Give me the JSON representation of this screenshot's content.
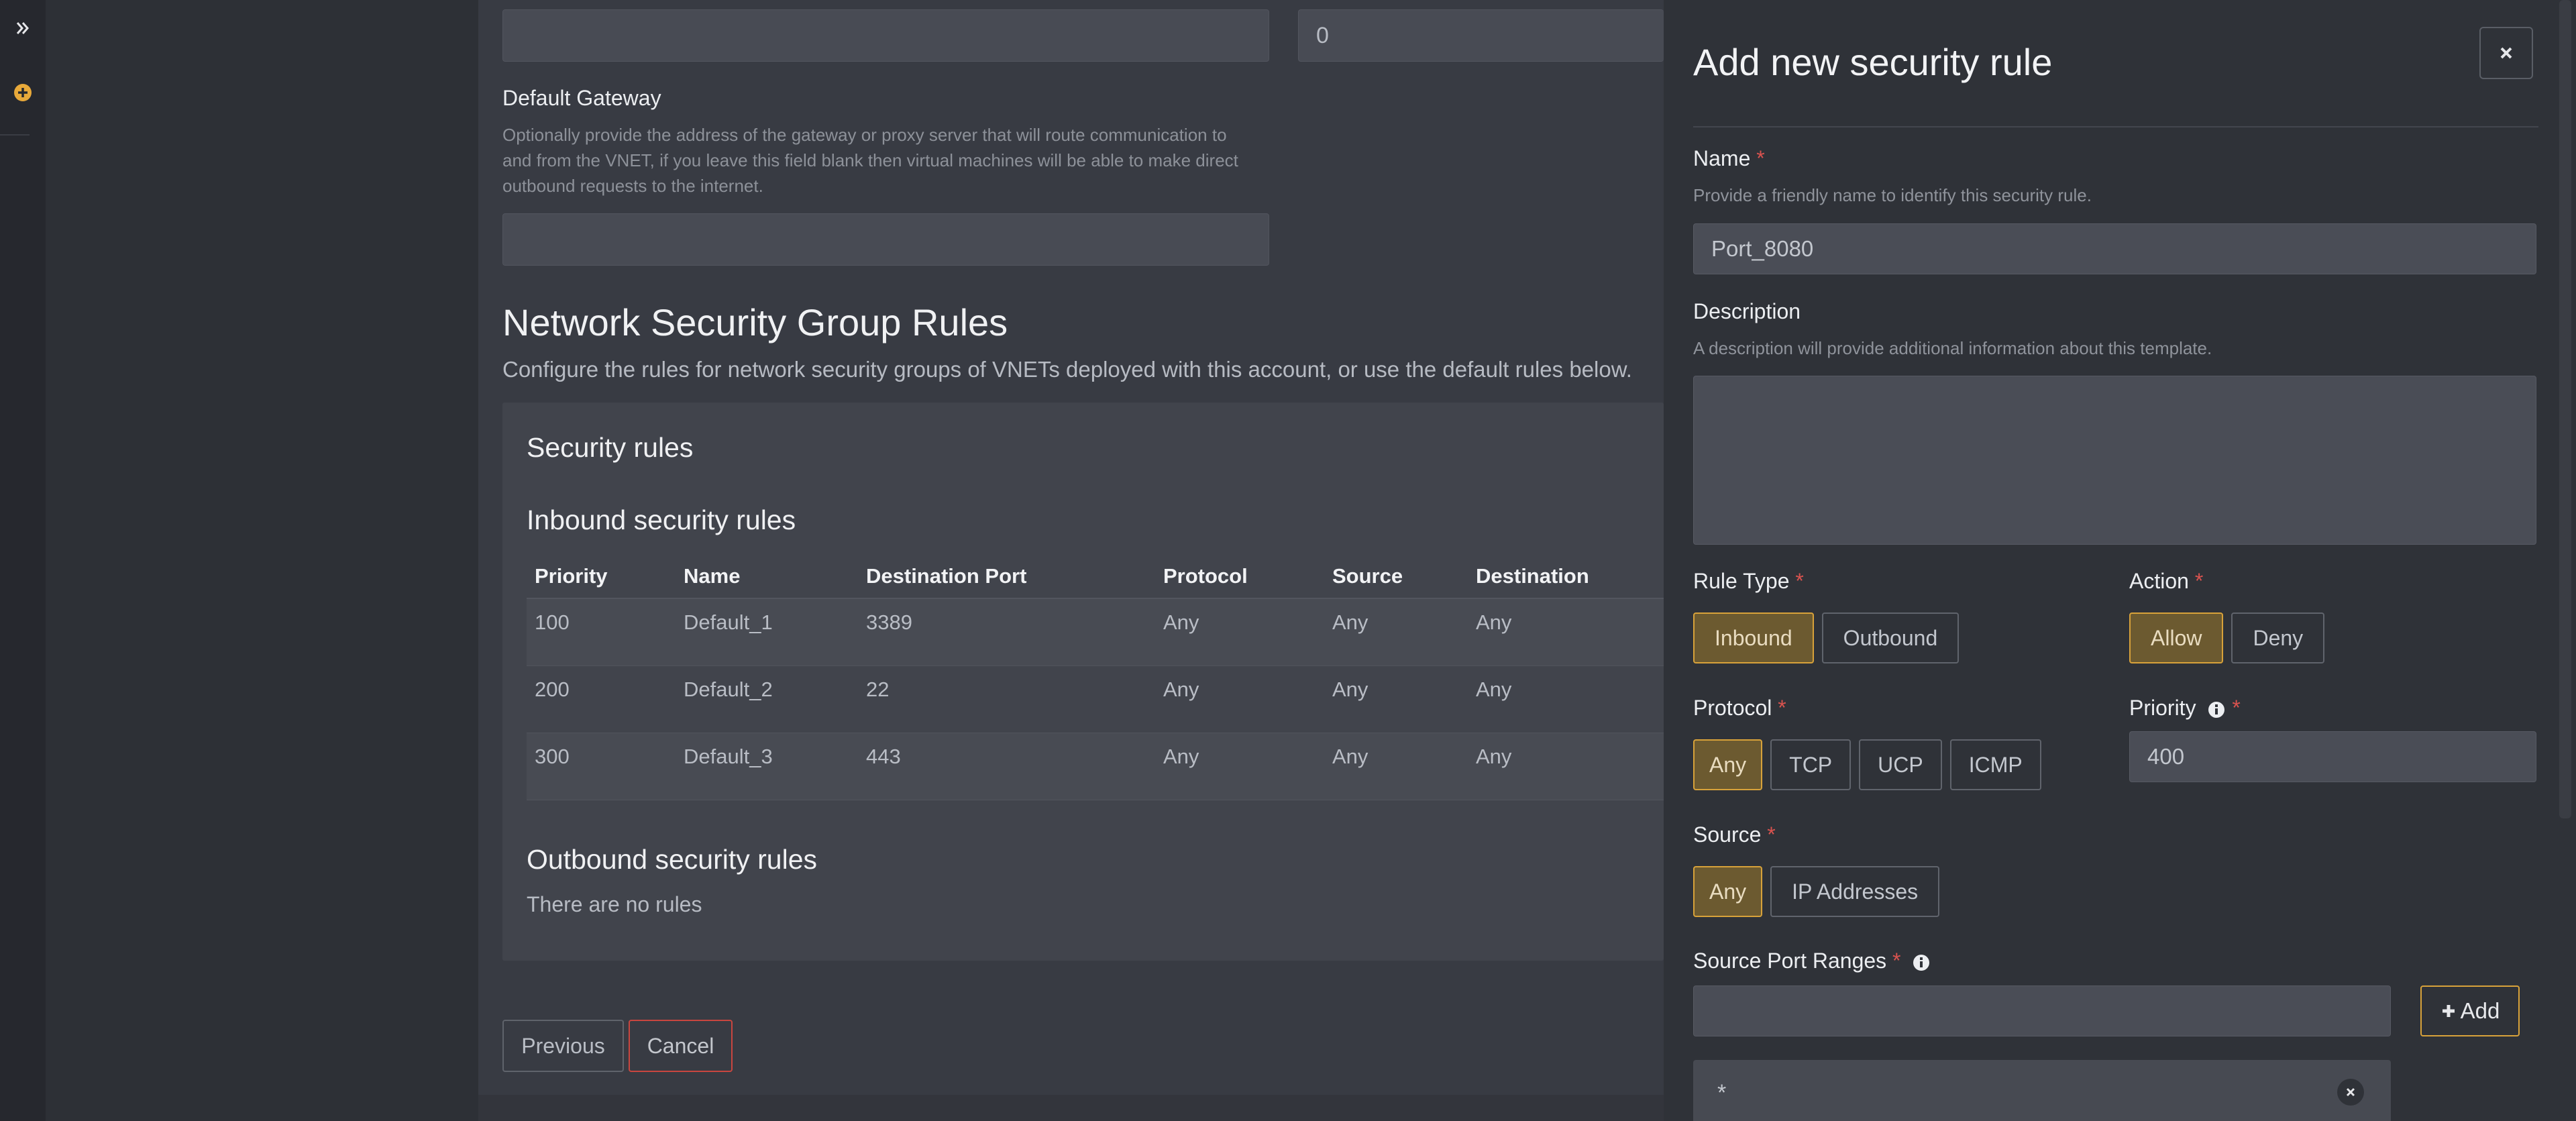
{
  "main": {
    "top_field_right_value": "0",
    "gateway": {
      "label": "Default Gateway",
      "help_line1": "Optionally provide the address of the gateway or proxy server that will route communication to",
      "help_line2": "and from the VNET, if you leave this field blank then virtual machines will be able to make direct",
      "help_line3": "outbound requests to the internet."
    },
    "nsg": {
      "title": "Network Security Group Rules",
      "description": "Configure the rules for network security groups of VNETs deployed with this account, or use the default rules below."
    },
    "card": {
      "title": "Security rules",
      "inbound_title": "Inbound security rules",
      "outbound_title": "Outbound security rules",
      "outbound_empty": "There are no rules",
      "columns": [
        "Priority",
        "Name",
        "Destination Port",
        "Protocol",
        "Source",
        "Destination"
      ],
      "rows": [
        [
          "100",
          "Default_1",
          "3389",
          "Any",
          "Any",
          "Any"
        ],
        [
          "200",
          "Default_2",
          "22",
          "Any",
          "Any",
          "Any"
        ],
        [
          "300",
          "Default_3",
          "443",
          "Any",
          "Any",
          "Any"
        ]
      ]
    },
    "buttons": {
      "previous": "Previous",
      "cancel": "Cancel"
    }
  },
  "drawer": {
    "title": "Add new security rule",
    "name": {
      "label": "Name",
      "help": "Provide a friendly name to identify this security rule.",
      "value": "Port_8080"
    },
    "description": {
      "label": "Description",
      "help": "A description will provide additional information about this template.",
      "value": ""
    },
    "rule_type": {
      "label": "Rule Type",
      "options": [
        "Inbound",
        "Outbound"
      ]
    },
    "action": {
      "label": "Action",
      "options": [
        "Allow",
        "Deny"
      ]
    },
    "protocol": {
      "label": "Protocol",
      "options": [
        "Any",
        "TCP",
        "UCP",
        "ICMP"
      ]
    },
    "priority": {
      "label": "Priority",
      "value": "400"
    },
    "source": {
      "label": "Source",
      "options": [
        "Any",
        "IP Addresses"
      ]
    },
    "source_ports": {
      "label": "Source Port Ranges",
      "value": "",
      "add_label": "Add",
      "chip": "*"
    },
    "required_mark": "*"
  },
  "colors": {
    "accent": "#d8a23a",
    "danger": "#d9534f",
    "panel": "#2f3238"
  }
}
